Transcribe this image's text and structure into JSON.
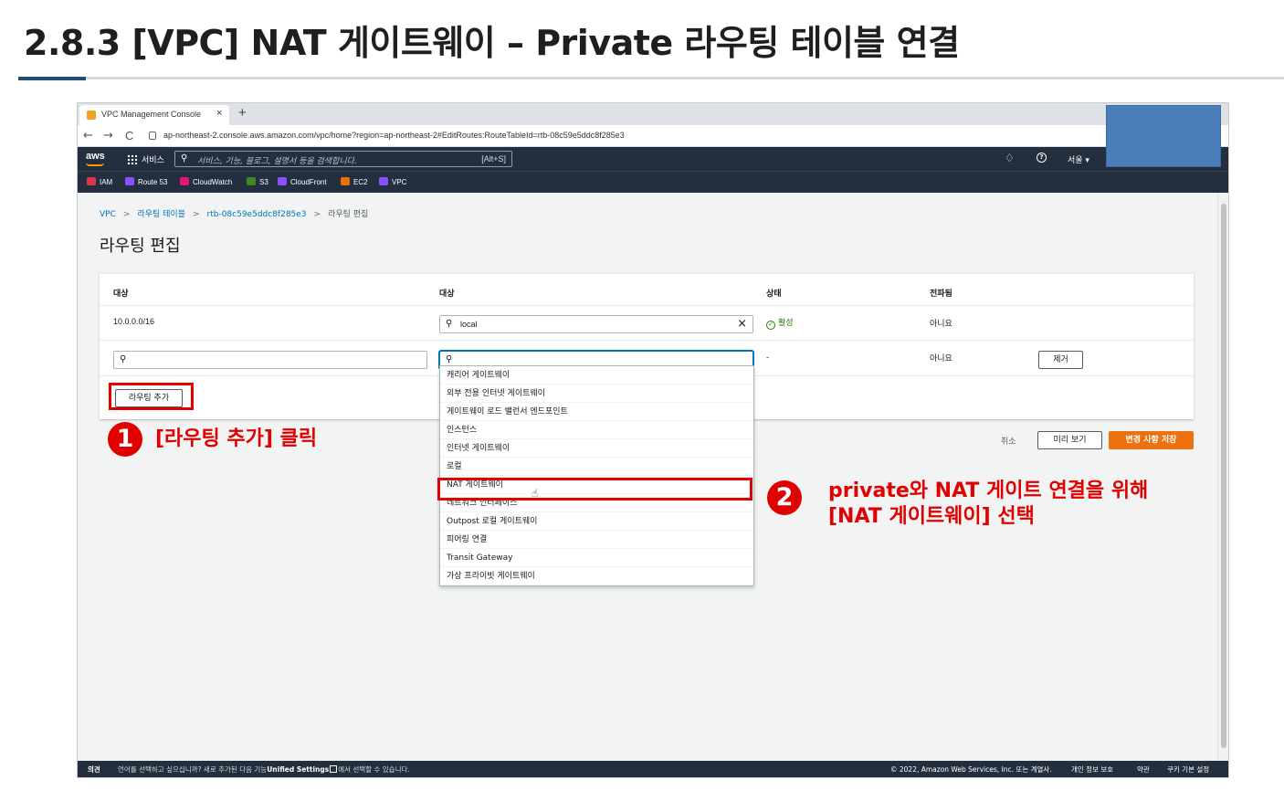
{
  "slide": {
    "title": "2.8.3 [VPC] NAT 게이트웨이 – Private 라우팅 테이블 연결"
  },
  "browser": {
    "tab_title": "VPC Management Console",
    "tab_close": "×",
    "new_tab": "+",
    "url": "ap-northeast-2.console.aws.amazon.com/vpc/home?region=ap-northeast-2#EditRoutes:RouteTableId=rtb-08c59e5ddc8f285e3",
    "back": "←",
    "forward": "→",
    "reload": "C"
  },
  "aws_header": {
    "logo": "aws",
    "services": "서비스",
    "search_placeholder": "서비스, 기능, 블로그, 설명서 등을 검색합니다.",
    "search_shortcut": "[Alt+S]",
    "region": "서울 ▾",
    "help": "?"
  },
  "favorites": [
    {
      "label": "IAM",
      "color": "#dd344c"
    },
    {
      "label": "Route 53",
      "color": "#8c4fff"
    },
    {
      "label": "CloudWatch",
      "color": "#e7157b"
    },
    {
      "label": "S3",
      "color": "#3f8624"
    },
    {
      "label": "CloudFront",
      "color": "#8c4fff"
    },
    {
      "label": "EC2",
      "color": "#ed7100"
    },
    {
      "label": "VPC",
      "color": "#8c4fff"
    }
  ],
  "breadcrumb": {
    "vpc": "VPC",
    "route_tables": "라우팅 테이블",
    "rtb_id": "rtb-08c59e5ddc8f285e3",
    "current": "라우팅 편집",
    "separator": ">"
  },
  "page_title": "라우팅 편집",
  "routes_table": {
    "headers": {
      "destination": "대상",
      "target": "대상",
      "status": "상태",
      "propagated": "전파됨"
    },
    "row1": {
      "destination": "10.0.0.0/16",
      "target": "local",
      "status": "활성",
      "propagated": "아니요"
    },
    "row2": {
      "destination": "",
      "target": "",
      "status": "-",
      "propagated": "아니요",
      "remove": "제거"
    },
    "add_route": "라우팅 추가"
  },
  "footer_actions": {
    "cancel": "취소",
    "preview": "미리 보기",
    "save": "변경 사항 저장"
  },
  "target_options": [
    "캐리어 게이트웨이",
    "외부 전용 인터넷 게이트웨이",
    "게이트웨이 로드 밸런서 엔드포인트",
    "인스턴스",
    "인터넷 게이트웨이",
    "로컬",
    "NAT 게이트웨이",
    "네트워크 인터페이스",
    "Outpost 로컬 게이트웨이",
    "피어링 연결",
    "Transit Gateway",
    "가상 프라이빗 게이트웨이"
  ],
  "annotations": {
    "step1_num": "1",
    "step1_text": "[라우팅 추가] 클릭",
    "step2_num": "2",
    "step2_line1": "private와 NAT 게이트 연결을 위해",
    "step2_line2": "[NAT 게이트웨이] 선택"
  },
  "console_footer": {
    "feedback": "의견",
    "language_note_prefix": "언어를 선택하고 싶으십니까? 새로 추가된 다음 기능",
    "unified_settings": "Unified Settings",
    "language_note_suffix": "에서 선택할 수 있습니다.",
    "copyright": "© 2022, Amazon Web Services, Inc. 또는 계열사.",
    "privacy": "개인 정보 보호",
    "terms": "약관",
    "cookies": "쿠키 기본 설정"
  },
  "colors": {
    "aws_nav": "#232f3e",
    "aws_orange": "#ec7211",
    "link_blue": "#0073bb",
    "annotation_red": "#e00000",
    "success_green": "#1d8102"
  }
}
